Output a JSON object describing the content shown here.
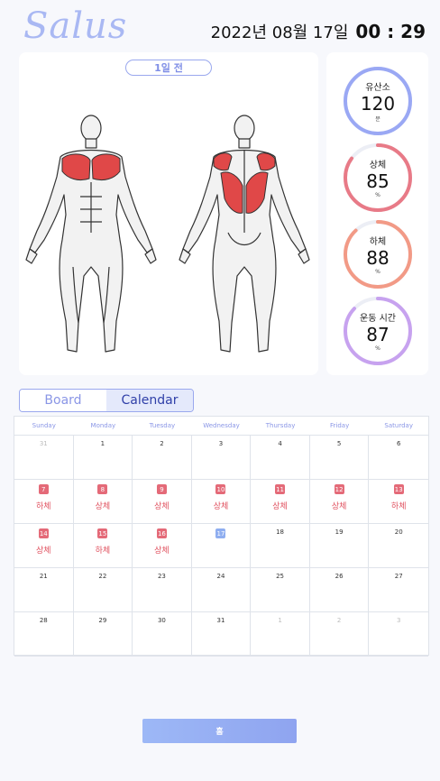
{
  "app": {
    "logo": "Salus"
  },
  "header": {
    "date": "2022년 08월 17일",
    "time": "00 : 29"
  },
  "body_panel": {
    "ago_label": "1일 전"
  },
  "stats": [
    {
      "label": "유산소",
      "value": "120",
      "unit": "분",
      "percent": 100,
      "color": "#9aa8f4"
    },
    {
      "label": "상체",
      "value": "85",
      "unit": "%",
      "percent": 85,
      "color": "#e87a87"
    },
    {
      "label": "하체",
      "value": "88",
      "unit": "%",
      "percent": 88,
      "color": "#f29a86"
    },
    {
      "label": "운동 시간",
      "value": "87",
      "unit": "%",
      "percent": 87,
      "color": "#c7a2ef"
    }
  ],
  "tabs": [
    {
      "label": "Board",
      "active": false
    },
    {
      "label": "Calendar",
      "active": true
    }
  ],
  "calendar": {
    "weekdays": [
      "Sunday",
      "Monday",
      "Tuesday",
      "Wednesday",
      "Thursday",
      "Friday",
      "Saturday"
    ],
    "days": [
      {
        "day": "31",
        "dim": true
      },
      {
        "day": "1"
      },
      {
        "day": "2"
      },
      {
        "day": "3"
      },
      {
        "day": "4"
      },
      {
        "day": "5"
      },
      {
        "day": "6"
      },
      {
        "day": "7",
        "mark": true,
        "event": "하체"
      },
      {
        "day": "8",
        "mark": true,
        "event": "상체"
      },
      {
        "day": "9",
        "mark": true,
        "event": "상체"
      },
      {
        "day": "10",
        "mark": true,
        "event": "상체"
      },
      {
        "day": "11",
        "mark": true,
        "event": "상체"
      },
      {
        "day": "12",
        "mark": true,
        "event": "상체"
      },
      {
        "day": "13",
        "mark": true,
        "event": "하체"
      },
      {
        "day": "14",
        "mark": true,
        "event": "상체"
      },
      {
        "day": "15",
        "mark": true,
        "event": "하체"
      },
      {
        "day": "16",
        "mark": true,
        "event": "상체"
      },
      {
        "day": "17",
        "today": true
      },
      {
        "day": "18"
      },
      {
        "day": "19"
      },
      {
        "day": "20"
      },
      {
        "day": "21"
      },
      {
        "day": "22"
      },
      {
        "day": "23"
      },
      {
        "day": "24"
      },
      {
        "day": "25"
      },
      {
        "day": "26"
      },
      {
        "day": "27"
      },
      {
        "day": "28"
      },
      {
        "day": "29"
      },
      {
        "day": "30"
      },
      {
        "day": "31"
      },
      {
        "day": "1",
        "dim": true
      },
      {
        "day": "2",
        "dim": true
      },
      {
        "day": "3",
        "dim": true
      }
    ]
  },
  "footer": {
    "home_label": "홈"
  }
}
